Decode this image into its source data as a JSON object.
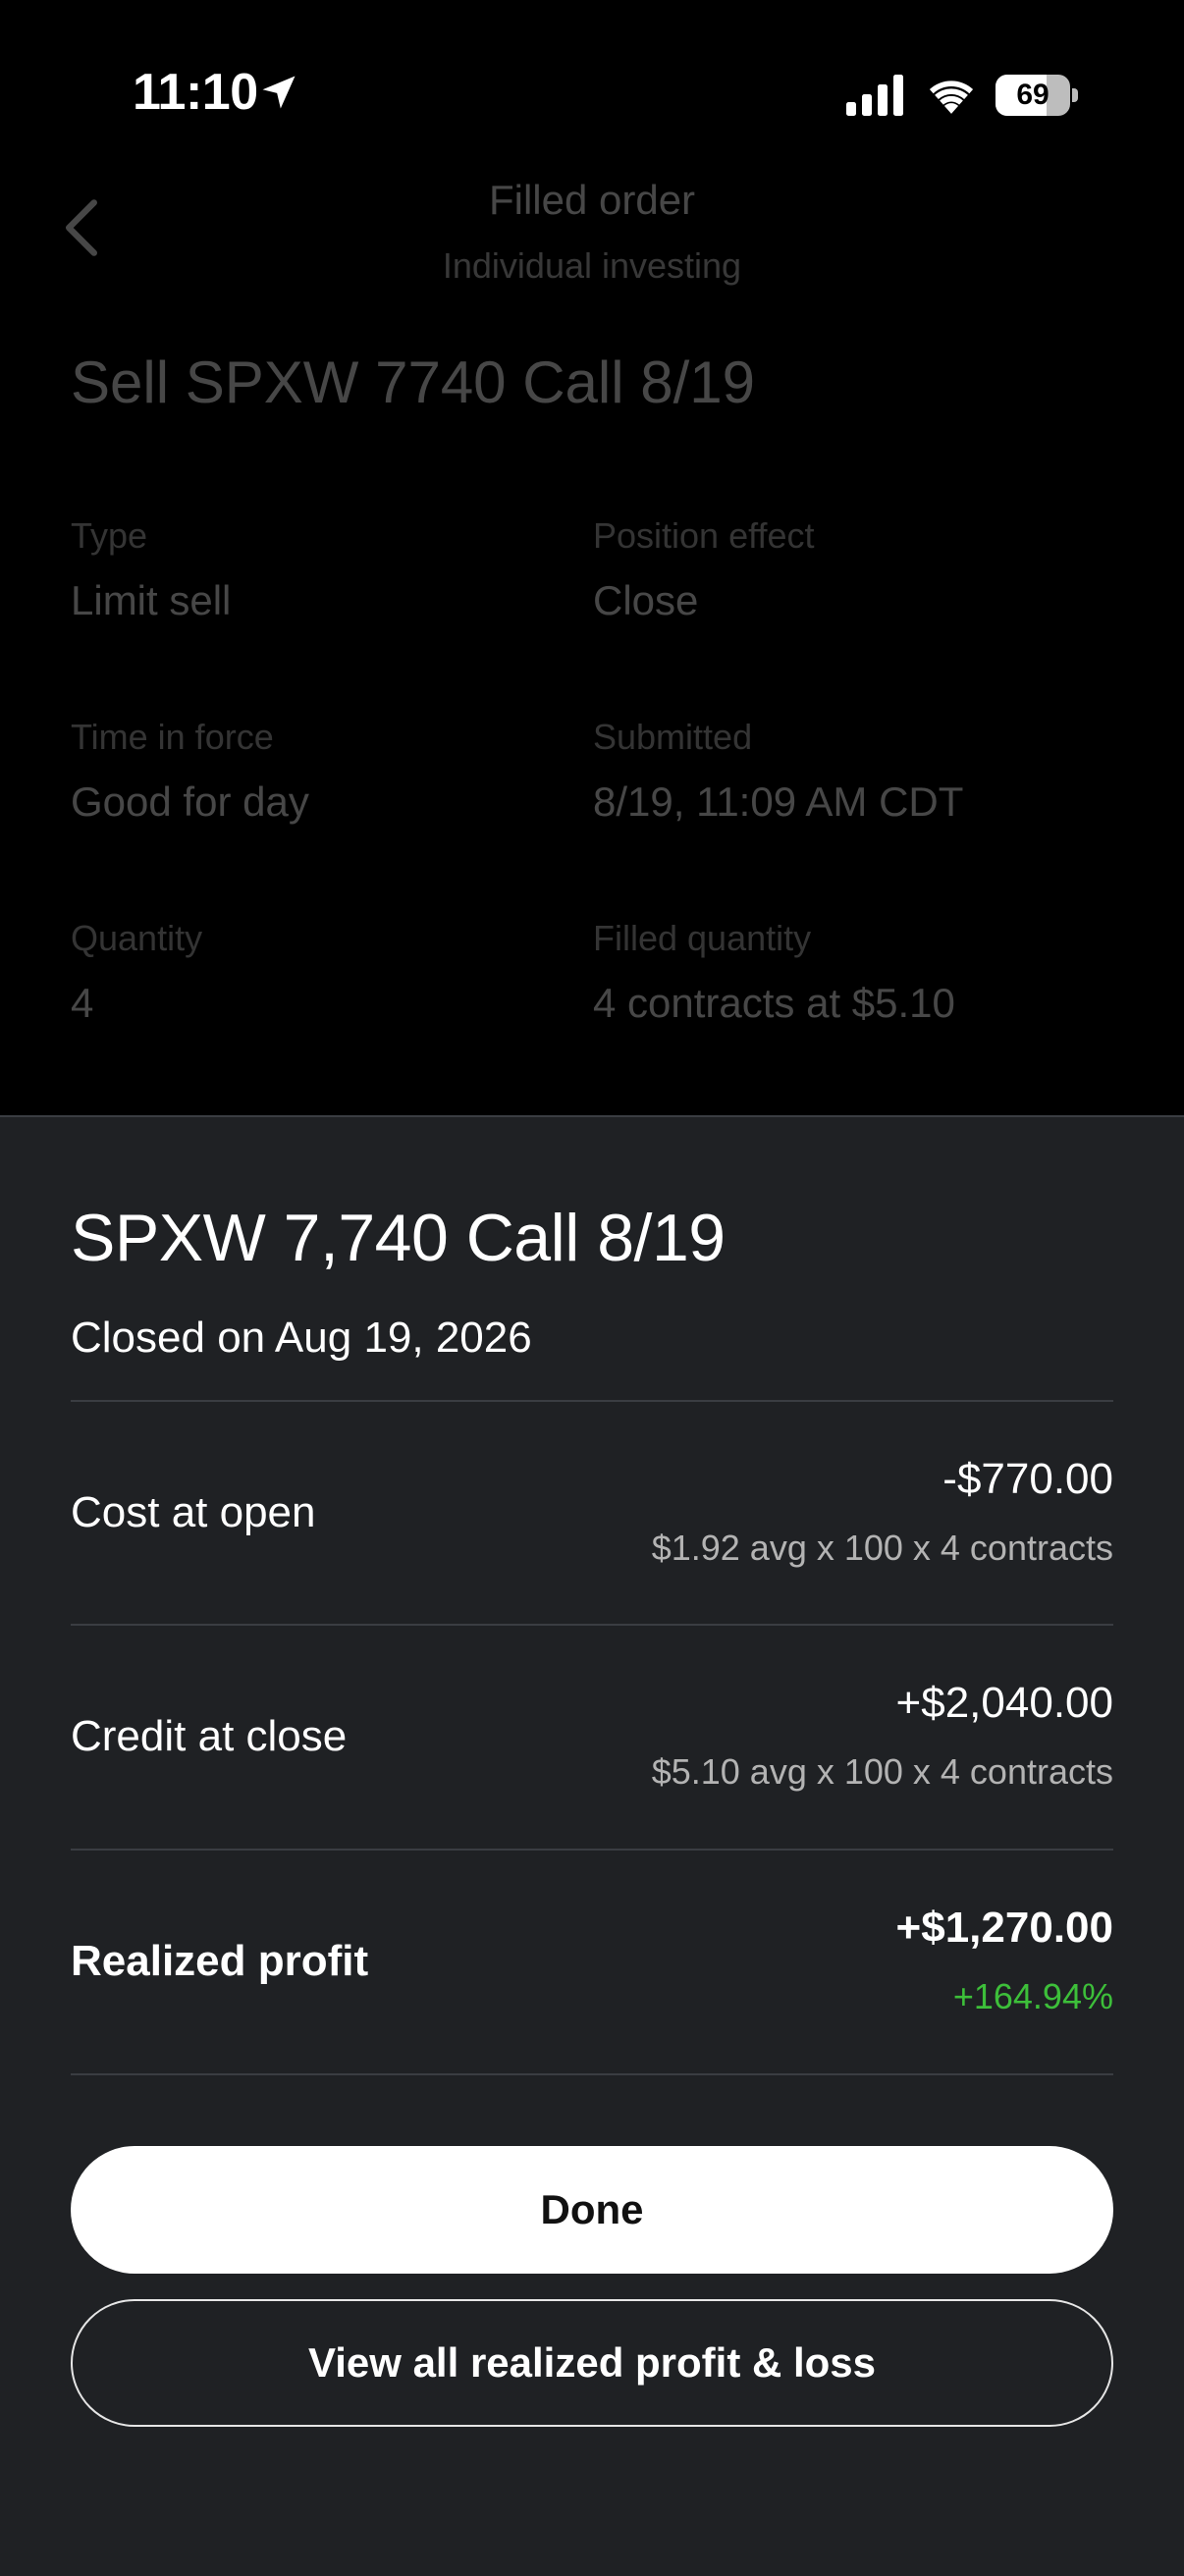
{
  "status_bar": {
    "time": "11:10",
    "battery": "69",
    "battery_level": 0.69
  },
  "background": {
    "nav_title": "Filled order",
    "nav_subtitle": "Individual investing",
    "order_title": "Sell SPXW 7740 Call 8/19",
    "fields": [
      {
        "label": "Type",
        "value": "Limit sell"
      },
      {
        "label": "Position effect",
        "value": "Close"
      },
      {
        "label": "Time in force",
        "value": "Good for day"
      },
      {
        "label": "Submitted",
        "value": "8/19, 11:09 AM CDT"
      },
      {
        "label": "Quantity",
        "value": "4"
      },
      {
        "label": "Filled quantity",
        "value": "4 contracts at $5.10"
      }
    ]
  },
  "sheet": {
    "title": "SPXW 7,740 Call 8/19",
    "subtitle": "Closed on Aug 19, 2026",
    "rows": [
      {
        "label": "Cost at open",
        "amount": "-$770.00",
        "detail": "$1.92 avg x 100 x 4 contracts"
      },
      {
        "label": "Credit at close",
        "amount": "+$2,040.00",
        "detail": "$5.10 avg x 100 x 4 contracts"
      },
      {
        "label": "Realized profit",
        "amount": "+$1,270.00",
        "detail": "+164.94%"
      }
    ],
    "done_label": "Done",
    "view_all_label": "View all realized profit & loss"
  },
  "colors": {
    "sheet_bg": "#1f2124",
    "positive": "#3dbf3a"
  },
  "icons": [
    "location-arrow-icon",
    "cellular-signal-icon",
    "wifi-icon",
    "battery-icon",
    "chevron-left-icon"
  ]
}
